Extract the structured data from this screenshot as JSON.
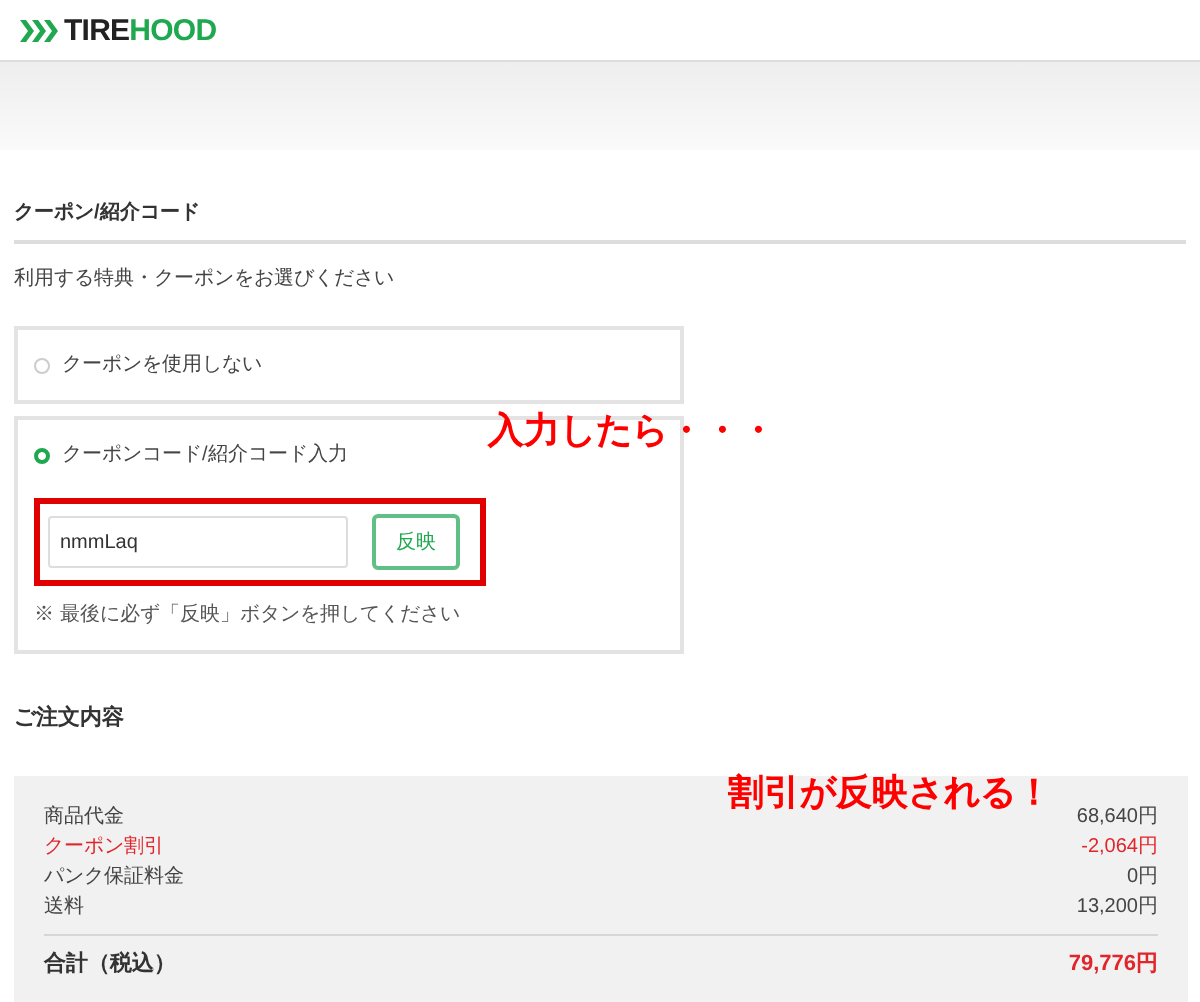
{
  "logo": {
    "dark": "TIRE",
    "green": "HOOD"
  },
  "coupon_section": {
    "title": "クーポン/紹介コード",
    "description": "利用する特典・クーポンをお選びください",
    "options": [
      {
        "label": "クーポンを使用しない",
        "selected": false
      },
      {
        "label": "クーポンコード/紹介コード入力",
        "selected": true
      }
    ],
    "code_value": "nmmLaq",
    "apply_button": "反映",
    "note": "※ 最後に必ず「反映」ボタンを押してください"
  },
  "annotations": {
    "input_note": "入力したら・・・",
    "result_note": "割引が反映される！"
  },
  "order": {
    "title": "ご注文内容",
    "rows": [
      {
        "label": "商品代金",
        "amount": "68,640円",
        "kind": "normal"
      },
      {
        "label": "クーポン割引",
        "amount": "-2,064円",
        "kind": "discount"
      },
      {
        "label": "パンク保証料金",
        "amount": "0円",
        "kind": "normal"
      },
      {
        "label": "送料",
        "amount": "13,200円",
        "kind": "normal"
      }
    ],
    "total_label": "合計（税込）",
    "total_amount": "79,776円"
  }
}
